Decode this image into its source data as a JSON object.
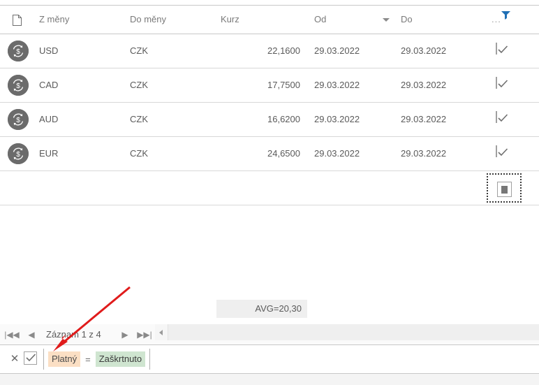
{
  "grid": {
    "columns": [
      {
        "key": "doc",
        "label": "",
        "icon": "document-icon"
      },
      {
        "key": "from",
        "label": "Z měny"
      },
      {
        "key": "to",
        "label": "Do měny"
      },
      {
        "key": "rate",
        "label": "Kurz"
      },
      {
        "key": "from_date",
        "label": "Od"
      },
      {
        "key": "to_date",
        "label": "Do"
      },
      {
        "key": "more",
        "label": "..."
      }
    ],
    "sort_indicator": "sort-descending-icon",
    "filter_icon": "filter-funnel-icon",
    "filter_icon_color": "#1f6fb5",
    "rows": [
      {
        "icon": "currency-exchange-icon",
        "from": "USD",
        "to": "CZK",
        "rate": "22,1600",
        "from_date": "29.03.2022",
        "to_date": "29.03.2022",
        "valid": "checked"
      },
      {
        "icon": "currency-exchange-icon",
        "from": "CAD",
        "to": "CZK",
        "rate": "17,7500",
        "from_date": "29.03.2022",
        "to_date": "29.03.2022",
        "valid": "checked"
      },
      {
        "icon": "currency-exchange-icon",
        "from": "AUD",
        "to": "CZK",
        "rate": "16,6200",
        "from_date": "29.03.2022",
        "to_date": "29.03.2022",
        "valid": "checked"
      },
      {
        "icon": "currency-exchange-icon",
        "from": "EUR",
        "to": "CZK",
        "rate": "24,6500",
        "from_date": "29.03.2022",
        "to_date": "29.03.2022",
        "valid": "checked"
      }
    ],
    "new_row": {
      "from": "",
      "to": "",
      "rate": "",
      "from_date": "",
      "to_date": "",
      "valid": "indeterminate"
    }
  },
  "aggregate": {
    "label": "AVG=20,30"
  },
  "navigator": {
    "first_label": "|◀◀",
    "prev_label": "◀",
    "record_label": "Záznam 1 z 4",
    "next_label": "▶",
    "last_label": "▶▶|"
  },
  "filter_bar": {
    "close_label": "✕",
    "enabled": "checked",
    "field": "Platný",
    "operator": "=",
    "value": "Zaškrtnuto"
  },
  "annotation": {
    "arrow_color": "#e01b1b",
    "points_to": "filter-field-chip"
  }
}
